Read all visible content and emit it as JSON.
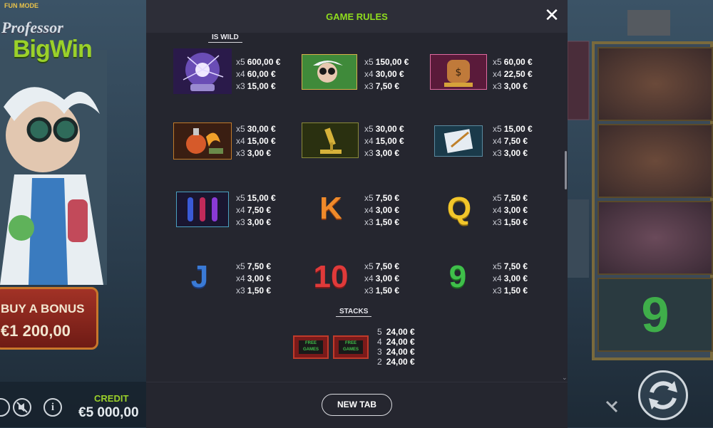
{
  "game": {
    "mode_label": "FUN MODE",
    "logo_line1": "Professor",
    "logo_line2": "BigWin",
    "bonus": {
      "label": "BUY A BONUS",
      "price": "€1 200,00"
    },
    "credit": {
      "label": "CREDIT",
      "value": "€5 000,00"
    }
  },
  "modal": {
    "title": "GAME RULES",
    "close_icon": "close-icon",
    "footer_button": "NEW TAB",
    "wild_tag": "IS WILD",
    "stacks_tag": "STACKS"
  },
  "paytable": [
    {
      "symbol": "plasma-ball",
      "pays": [
        {
          "m": "x5",
          "v": "600,00 €"
        },
        {
          "m": "x4",
          "v": "60,00 €"
        },
        {
          "m": "x3",
          "v": "15,00 €"
        }
      ]
    },
    {
      "symbol": "professor",
      "pays": [
        {
          "m": "x5",
          "v": "150,00 €"
        },
        {
          "m": "x4",
          "v": "30,00 €"
        },
        {
          "m": "x3",
          "v": "7,50 €"
        }
      ]
    },
    {
      "symbol": "money-jar",
      "pays": [
        {
          "m": "x5",
          "v": "60,00 €"
        },
        {
          "m": "x4",
          "v": "22,50 €"
        },
        {
          "m": "x3",
          "v": "3,00 €"
        }
      ]
    },
    {
      "symbol": "potion-flask",
      "pays": [
        {
          "m": "x5",
          "v": "30,00 €"
        },
        {
          "m": "x4",
          "v": "15,00 €"
        },
        {
          "m": "x3",
          "v": "3,00 €"
        }
      ]
    },
    {
      "symbol": "microscope",
      "pays": [
        {
          "m": "x5",
          "v": "30,00 €"
        },
        {
          "m": "x4",
          "v": "15,00 €"
        },
        {
          "m": "x3",
          "v": "3,00 €"
        }
      ]
    },
    {
      "symbol": "notepad",
      "pays": [
        {
          "m": "x5",
          "v": "15,00 €"
        },
        {
          "m": "x4",
          "v": "7,50 €"
        },
        {
          "m": "x3",
          "v": "3,00 €"
        }
      ]
    },
    {
      "symbol": "test-tubes",
      "pays": [
        {
          "m": "x5",
          "v": "15,00 €"
        },
        {
          "m": "x4",
          "v": "7,50 €"
        },
        {
          "m": "x3",
          "v": "3,00 €"
        }
      ]
    },
    {
      "symbol": "K",
      "pays": [
        {
          "m": "x5",
          "v": "7,50 €"
        },
        {
          "m": "x4",
          "v": "3,00 €"
        },
        {
          "m": "x3",
          "v": "1,50 €"
        }
      ]
    },
    {
      "symbol": "Q",
      "pays": [
        {
          "m": "x5",
          "v": "7,50 €"
        },
        {
          "m": "x4",
          "v": "3,00 €"
        },
        {
          "m": "x3",
          "v": "1,50 €"
        }
      ]
    },
    {
      "symbol": "J",
      "pays": [
        {
          "m": "x5",
          "v": "7,50 €"
        },
        {
          "m": "x4",
          "v": "3,00 €"
        },
        {
          "m": "x3",
          "v": "1,50 €"
        }
      ]
    },
    {
      "symbol": "10",
      "pays": [
        {
          "m": "x5",
          "v": "7,50 €"
        },
        {
          "m": "x4",
          "v": "3,00 €"
        },
        {
          "m": "x3",
          "v": "1,50 €"
        }
      ]
    },
    {
      "symbol": "9",
      "pays": [
        {
          "m": "x5",
          "v": "7,50 €"
        },
        {
          "m": "x4",
          "v": "3,00 €"
        },
        {
          "m": "x3",
          "v": "1,50 €"
        }
      ]
    }
  ],
  "card_letters": {
    "k": "K",
    "q": "Q",
    "j": "J",
    "ten": "10",
    "nine": "9"
  },
  "stacks": {
    "badge_text": "FREE GAMES",
    "rows": [
      {
        "m": "5",
        "v": "24,00 €"
      },
      {
        "m": "4",
        "v": "24,00 €"
      },
      {
        "m": "3",
        "v": "24,00 €"
      },
      {
        "m": "2",
        "v": "24,00 €"
      }
    ]
  },
  "colors": {
    "accent": "#8fdc1e",
    "panel": "#25262f",
    "header": "#2d2e38"
  }
}
